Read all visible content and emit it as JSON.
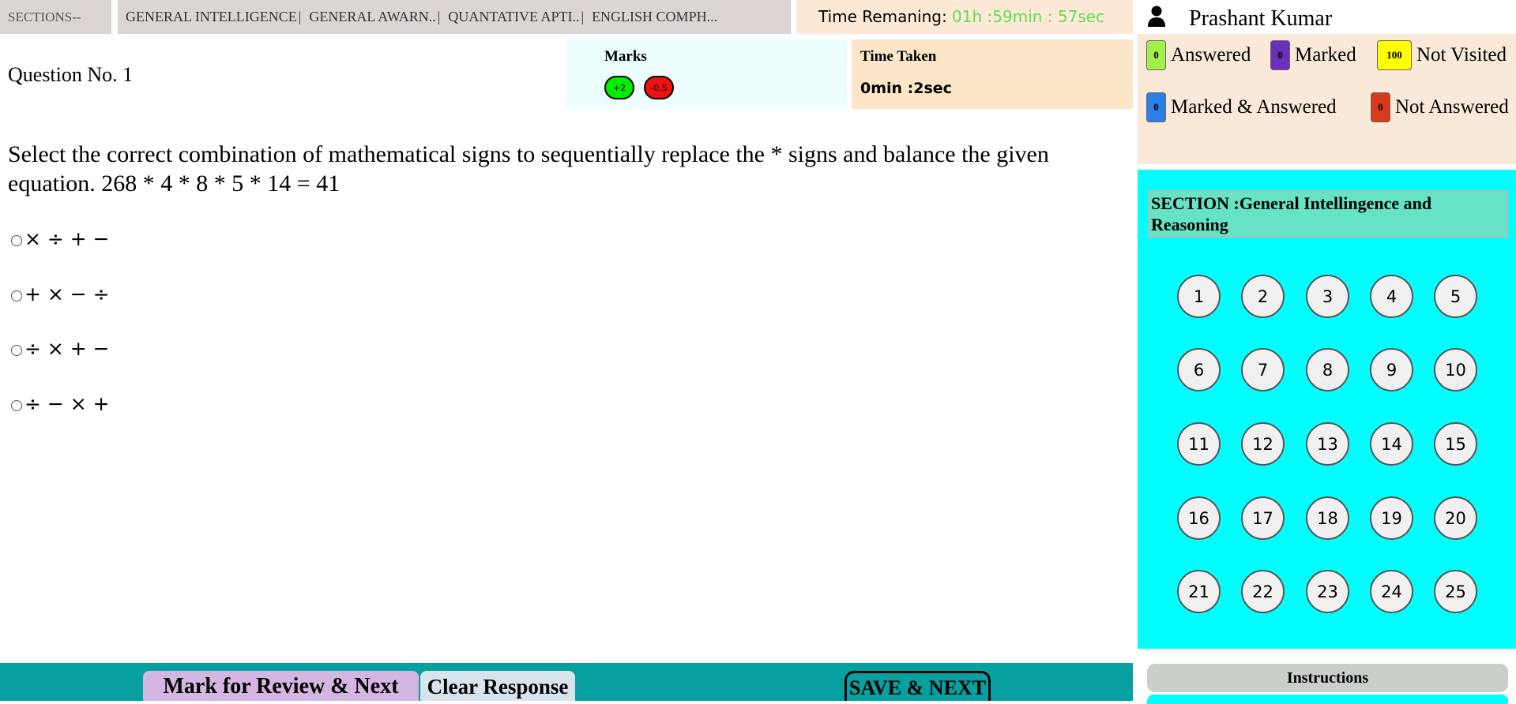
{
  "header": {
    "sections_label": "SECTIONS--",
    "section_tabs": [
      "GENERAL INTELLIGENCE",
      "GENERAL AWARN..",
      "QUANTATIVE APTI..",
      "ENGLISH COMPH..."
    ],
    "tab_separator": "|",
    "time_remaining_label": "Time Remaning:",
    "time_remaining_value": "01h :59min : 57sec"
  },
  "question": {
    "number_label": "Question No. 1",
    "marks_title": "Marks",
    "positive_mark": "+2",
    "negative_mark": "-0.5",
    "time_taken_title": "Time Taken",
    "time_taken_value": "0min :2sec",
    "text": "Select the correct combination of mathematical signs to sequentially replace the * signs and balance the given equation. 268 * 4 * 8 * 5 * 14 = 41",
    "options": [
      "× ÷ + −",
      "+ × − ÷",
      "÷ × + −",
      "÷ − × +"
    ]
  },
  "actions": {
    "mark_review_next": "Mark for Review & Next",
    "clear_response": "Clear Response",
    "save_next": "SAVE & NEXT"
  },
  "user": {
    "name": "Prashant Kumar"
  },
  "legend": {
    "answered": {
      "count": "0",
      "label": "Answered",
      "color": "#a3f04a"
    },
    "marked": {
      "count": "0",
      "label": "Marked",
      "color": "#6a2fbb"
    },
    "not_visited": {
      "count": "100",
      "label": "Not Visited",
      "color": "#ffff00"
    },
    "marked_answered": {
      "count": "0",
      "label": "Marked & Answered",
      "color": "#2a7fe8"
    },
    "not_answered": {
      "count": "0",
      "label": "Not Answered",
      "color": "#d93a1e"
    }
  },
  "palette": {
    "section_title": "SECTION :General Intellingence and Reasoning",
    "questions": [
      "1",
      "2",
      "3",
      "4",
      "5",
      "6",
      "7",
      "8",
      "9",
      "10",
      "11",
      "12",
      "13",
      "14",
      "15",
      "16",
      "17",
      "18",
      "19",
      "20",
      "21",
      "22",
      "23",
      "24",
      "25"
    ]
  },
  "footer": {
    "instructions": "Instructions"
  }
}
